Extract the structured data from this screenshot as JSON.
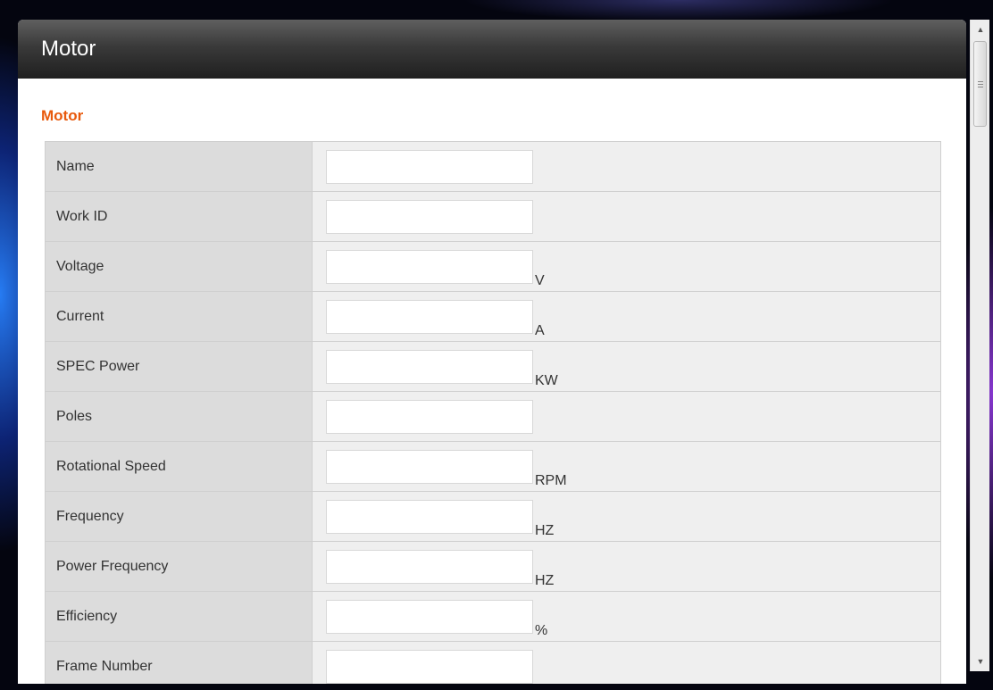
{
  "dialog": {
    "title": "Motor"
  },
  "section": {
    "title": "Motor",
    "title_color": "#e8590c"
  },
  "fields": [
    {
      "label": "Name",
      "value": "",
      "unit": ""
    },
    {
      "label": "Work ID",
      "value": "",
      "unit": ""
    },
    {
      "label": "Voltage",
      "value": "",
      "unit": "V"
    },
    {
      "label": "Current",
      "value": "",
      "unit": "A"
    },
    {
      "label": "SPEC Power",
      "value": "",
      "unit": "KW"
    },
    {
      "label": "Poles",
      "value": "",
      "unit": ""
    },
    {
      "label": "Rotational Speed",
      "value": "",
      "unit": "RPM"
    },
    {
      "label": "Frequency",
      "value": "",
      "unit": "HZ"
    },
    {
      "label": "Power Frequency",
      "value": "",
      "unit": "HZ"
    },
    {
      "label": "Efficiency",
      "value": "",
      "unit": "%"
    },
    {
      "label": "Frame Number",
      "value": "",
      "unit": ""
    }
  ],
  "scrollbar": {
    "up_icon": "arrow-up-icon",
    "down_icon": "arrow-down-icon"
  }
}
